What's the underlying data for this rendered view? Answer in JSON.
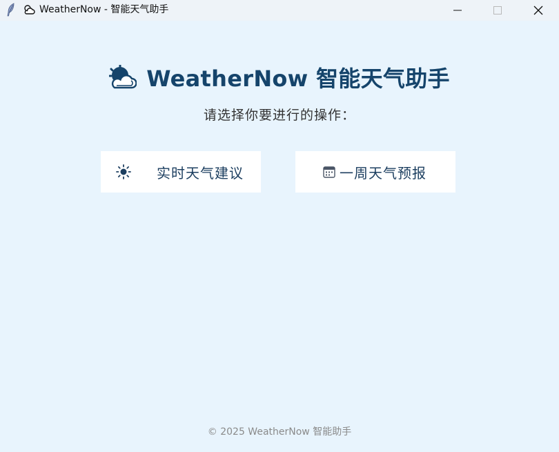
{
  "window": {
    "title": "WeatherNow - 智能天气助手",
    "app_icon": "feather-icon",
    "title_icon": "sun-behind-cloud-icon",
    "controls": [
      "minimize-icon",
      "maximize-icon",
      "close-icon"
    ]
  },
  "header": {
    "icon": "sun-behind-cloud-icon",
    "title": "WeatherNow 智能天气助手"
  },
  "subtitle": "请选择你要进行的操作：",
  "actions": [
    {
      "icon": "sun-icon",
      "label": "实时天气建议"
    },
    {
      "icon": "calendar-icon",
      "label": "一周天气预报"
    }
  ],
  "footer": "© 2025 WeatherNow 智能助手",
  "colors": {
    "background": "#e8f4fd",
    "titlebar": "#eef3f8",
    "heading": "#15446b",
    "card": "#ffffff",
    "card_text": "#1d3f60",
    "footer_text": "#8a8a8a"
  }
}
